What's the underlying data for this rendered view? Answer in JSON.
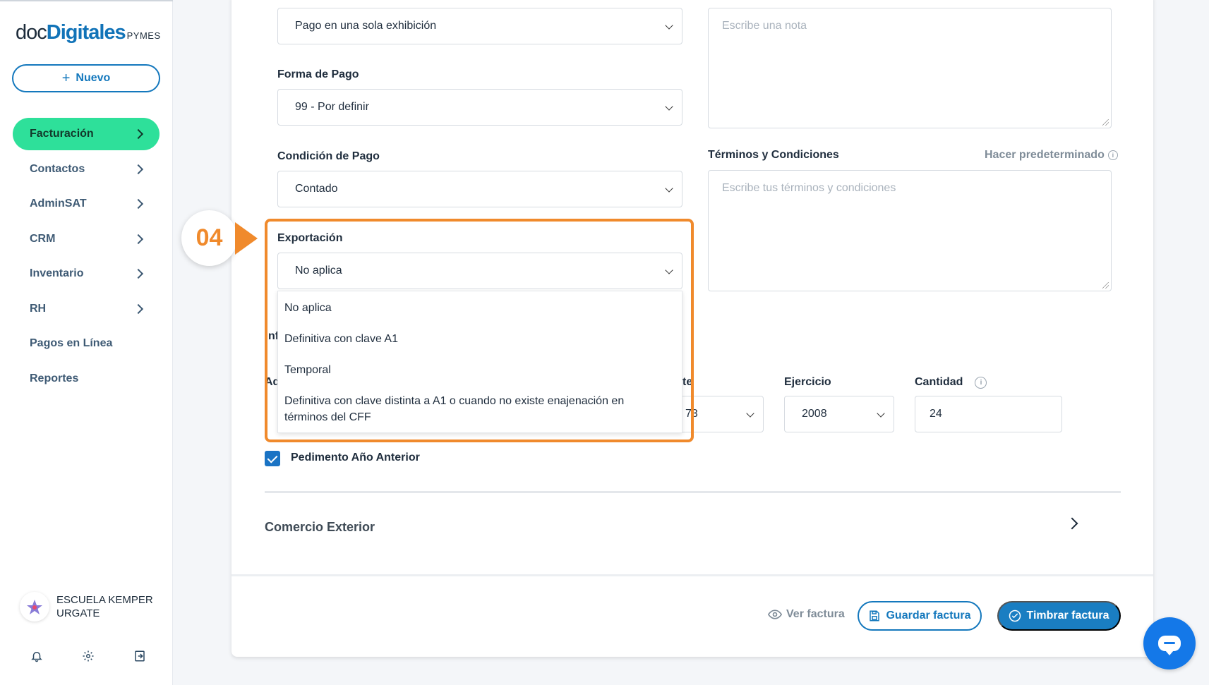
{
  "sidebar": {
    "logo": {
      "doc": "doc",
      "digitales": "Digitales",
      "pymes": "PYMES"
    },
    "new_button": {
      "icon": "plus-icon",
      "label": "Nuevo"
    },
    "items": [
      {
        "label": "Facturación",
        "active": true,
        "has_chevron": true
      },
      {
        "label": "Contactos",
        "active": false,
        "has_chevron": true
      },
      {
        "label": "AdminSAT",
        "active": false,
        "has_chevron": true
      },
      {
        "label": "CRM",
        "active": false,
        "has_chevron": true
      },
      {
        "label": "Inventario",
        "active": false,
        "has_chevron": true
      },
      {
        "label": "RH",
        "active": false,
        "has_chevron": true
      },
      {
        "label": "Pagos en Línea",
        "active": false,
        "has_chevron": false
      },
      {
        "label": "Reportes",
        "active": false,
        "has_chevron": false
      }
    ],
    "user": {
      "name": "ESCUELA KEMPER URGATE"
    },
    "footer_icons": [
      "bell-icon",
      "gear-icon",
      "logout-icon"
    ]
  },
  "form": {
    "metodo_pago": {
      "value": "Pago en una sola exhibición"
    },
    "nota": {
      "placeholder": "Escribe una nota"
    },
    "forma_pago": {
      "label": "Forma de Pago",
      "value": "99 - Por definir"
    },
    "condicion_pago": {
      "label": "Condición de Pago",
      "value": "Contado"
    },
    "terminos": {
      "label": "Términos y Condiciones",
      "placeholder": "Escribe tus términos y condiciones",
      "link": "Hacer predeterminado"
    },
    "exportacion": {
      "label": "Exportación",
      "value": "No aplica",
      "options": [
        "No aplica",
        "Definitiva con clave A1",
        "Temporal",
        "Definitiva con clave distinta a A1 o cuando no existe enajenación en términos del CFF"
      ]
    },
    "partial_labels": {
      "inf": "nf",
      "ad": "Ad",
      "te": "te",
      "val": "73"
    },
    "ejercicio": {
      "label": "Ejercicio",
      "value": "2008"
    },
    "cantidad": {
      "label": "Cantidad",
      "value": "24"
    },
    "pedimento_anterior": {
      "label": "Pedimento Año Anterior",
      "checked": true
    },
    "comercio_exterior": {
      "label": "Comercio Exterior"
    }
  },
  "annotation": {
    "step": "04",
    "accent": "#f08a2c"
  },
  "footer": {
    "ver_factura": "Ver factura",
    "guardar": "Guardar factura",
    "timbrar": "Timbrar factura"
  },
  "colors": {
    "primary": "#1478bd",
    "active_nav": "#2ee09a",
    "chat": "#1478e8"
  }
}
